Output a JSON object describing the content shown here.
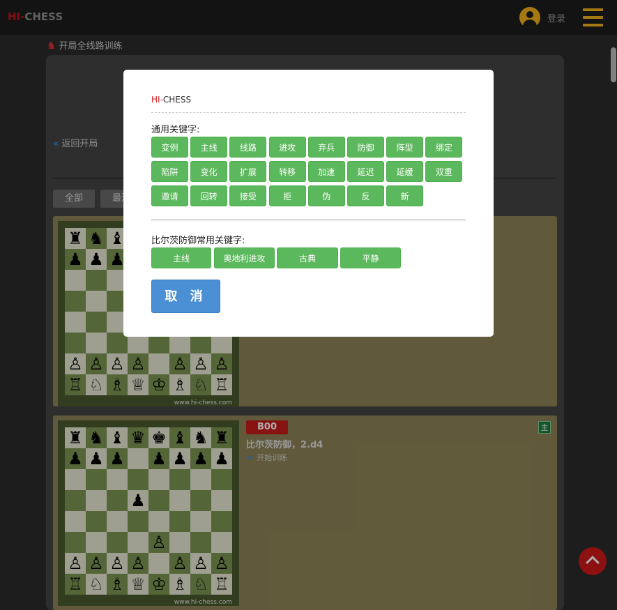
{
  "header": {
    "logo_hi": "HI-",
    "logo_rest": "CHESS",
    "login_label": "登录"
  },
  "page": {
    "breadcrumb": "开局全线路训练",
    "back_label": "返回开局",
    "filters": [
      "全部",
      "最滴"
    ]
  },
  "card2": {
    "eco": "B00",
    "line_name": "比尔茨防御，2.d4",
    "start_label": "开始训练",
    "tag": "主",
    "watermark": "www.hi-chess.com"
  },
  "card1": {
    "watermark": "www.hi-chess.com"
  },
  "modal": {
    "title_hi": "HI-",
    "title_rest": "CHESS",
    "general_label": "通用关键字:",
    "general_keywords": [
      "变例",
      "主线",
      "线路",
      "进攻",
      "弃兵",
      "防御",
      "阵型",
      "绑定",
      "陷阱",
      "变化",
      "扩展",
      "转移",
      "加速",
      "延迟",
      "延缓",
      "双重",
      "邀请",
      "回转",
      "接受",
      "拒",
      "伪",
      "反",
      "新"
    ],
    "specific_label": "比尔茨防御常用关键字:",
    "specific_keywords": [
      "主线",
      "奥地利进攻",
      "古典",
      "平静"
    ],
    "cancel_label": "取 消"
  },
  "colors": {
    "keyword_green": "#5cb85c",
    "cancel_blue": "#4b8fd4",
    "accent_gold": "#f3b21a",
    "brand_red": "#c0161c"
  }
}
